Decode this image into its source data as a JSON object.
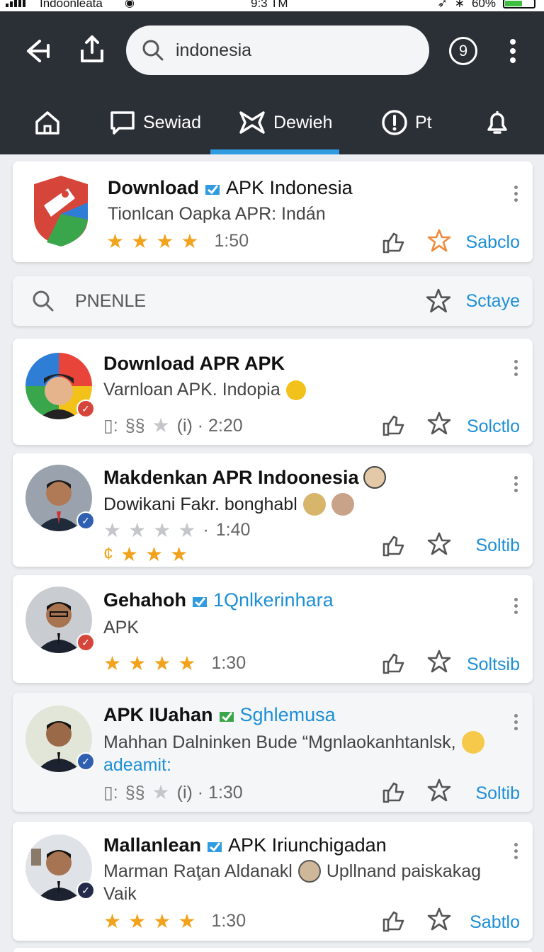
{
  "status": {
    "carrier": "Indoonleata",
    "time": "9:3 TM",
    "battery": "60%",
    "battery_level": 0.58
  },
  "search": {
    "value": "indonesia"
  },
  "header": {
    "help_label": "9"
  },
  "tabs": [
    {
      "label": ""
    },
    {
      "label": "Sewiad"
    },
    {
      "label": "Dewieh"
    },
    {
      "label": "Pt"
    },
    {
      "label": ""
    }
  ],
  "filter": {
    "label": "PNENLE",
    "action": "Sctaye"
  },
  "cards": [
    {
      "title": "Download",
      "title_link": "APK Indonesia",
      "subtitle": "Tionlcan Oapka APR: Indán",
      "rating": 4,
      "time": "1:50",
      "action": "Sabclo"
    },
    {
      "title": "Download APR APK",
      "subtitle": "Varnloan APK. Indopia",
      "meta_prefix": "(i) · 2:20",
      "action": "Solctlo"
    },
    {
      "title": "Makdenkan APR Indoonesia",
      "subtitle": "Dowikani Fakr. bonghabl",
      "rating_gray": 4,
      "time": "1:40",
      "rating_row2": 4,
      "row2_prefix": "¢",
      "action": "Soltib"
    },
    {
      "title": "Gehahoh",
      "title_link": "1Qnlkerinhara",
      "subtitle": "APK",
      "rating": 4,
      "time": "1:30",
      "action": "Soltsib"
    },
    {
      "title": "APK IUahan",
      "title_link": "Sghlemusa",
      "subtitle": "Mahhan Dalninken Bude “Mgnlaokanhtanlsk,",
      "subtitle2": "adeamit:",
      "meta_prefix": "(i) · 1:30",
      "action": "Soltib"
    },
    {
      "title": "Mallanlean",
      "title_link": "APK Iriunchigadan",
      "subtitle": "Marman Raţan Aldanakl",
      "subtitle_b": "Upllnand paiskakag",
      "subtitle2": "Vaik",
      "rating": 4,
      "time": "1:30",
      "action": "Sabtlo"
    }
  ],
  "colors": {
    "header_bg": "#2b2f36",
    "accent": "#1d8fd6",
    "star": "#f2a21b",
    "tab_indicator": "#2f9be0"
  }
}
